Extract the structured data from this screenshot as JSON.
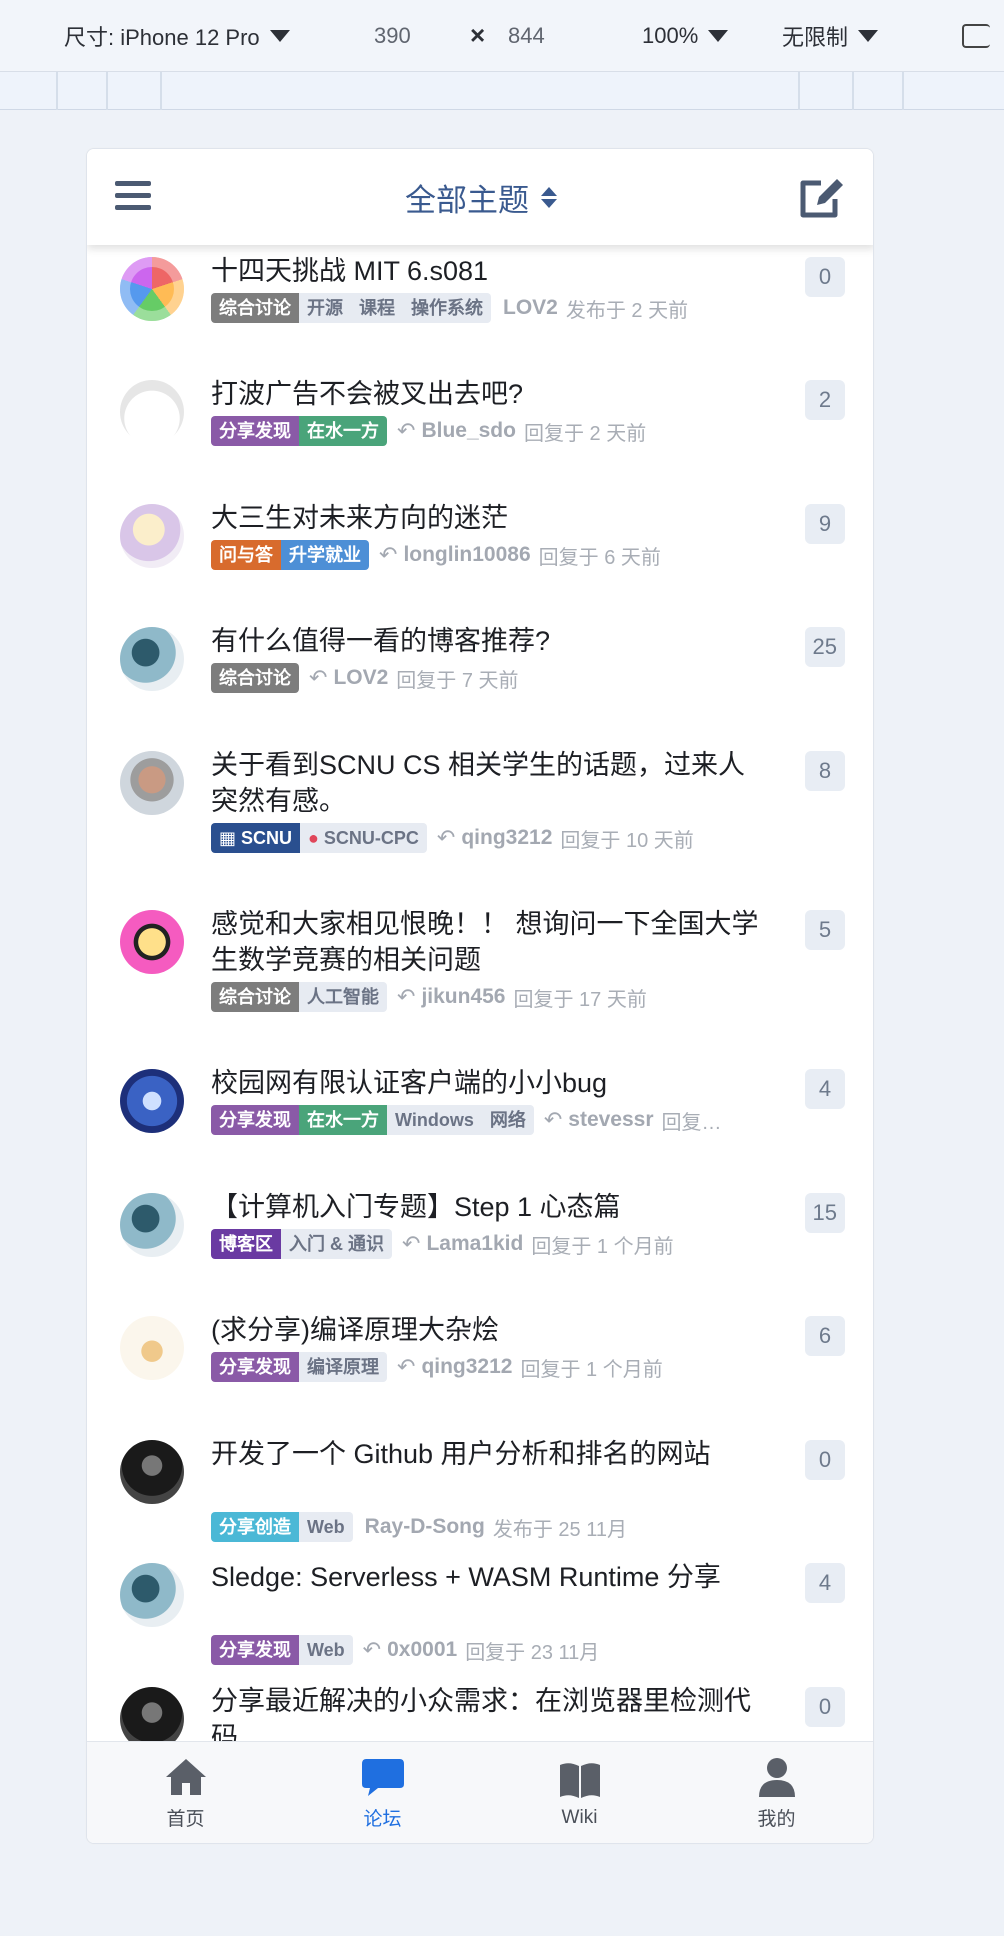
{
  "devtools": {
    "device": "尺寸: iPhone 12 Pro",
    "width": "390",
    "times": "×",
    "height": "844",
    "zoom": "100%",
    "throttle": "无限制"
  },
  "header": {
    "title": "全部主题"
  },
  "topics": [
    {
      "title": "十四天挑战 MIT 6.s081",
      "tags": [
        {
          "label": "综合讨论",
          "color": "#7d7d7d"
        },
        {
          "label": "开源",
          "sub": true
        },
        {
          "label": "课程",
          "sub": true
        },
        {
          "label": "操作系统",
          "sub": true
        }
      ],
      "reply": false,
      "user": "LOV2",
      "when": "发布于 2 天前",
      "count": "0"
    },
    {
      "title": "打波广告不会被叉出去吧?",
      "tags": [
        {
          "label": "分享发现",
          "color": "#8a5aa7"
        },
        {
          "label": "在水一方",
          "color": "#4aa47a"
        }
      ],
      "reply": true,
      "user": "Blue_sdo",
      "when": "回复于 2 天前",
      "count": "2"
    },
    {
      "title": "大三生对未来方向的迷茫",
      "tags": [
        {
          "label": "问与答",
          "color": "#d86b2d"
        },
        {
          "label": "升学就业",
          "color": "#4d8fd6"
        }
      ],
      "reply": true,
      "user": "longlin10086",
      "when": "回复于 6 天前",
      "count": "9"
    },
    {
      "title": "有什么值得一看的博客推荐?",
      "tags": [
        {
          "label": "综合讨论",
          "color": "#7d7d7d"
        }
      ],
      "reply": true,
      "user": "LOV2",
      "when": "回复于 7 天前",
      "count": "25"
    },
    {
      "title": "关于看到SCNU CS 相关学生的话题，过来人突然有感。",
      "tags": [
        {
          "label": "SCNU",
          "color": "#2a4f8f",
          "icon": true
        },
        {
          "label": "SCNU-CPC",
          "sub": true,
          "pin": true
        }
      ],
      "reply": true,
      "user": "qing3212",
      "when": "回复于 10 天前",
      "count": "8"
    },
    {
      "title": "感觉和大家相见恨晚！！ 想询问一下全国大学生数学竞赛的相关问题",
      "tags": [
        {
          "label": "综合讨论",
          "color": "#7d7d7d"
        },
        {
          "label": "人工智能",
          "sub": true
        }
      ],
      "reply": true,
      "user": "jikun456",
      "when": "回复于 17 天前",
      "count": "5"
    },
    {
      "title": "校园网有限认证客户端的小小bug",
      "tags": [
        {
          "label": "分享发现",
          "color": "#8a5aa7"
        },
        {
          "label": "在水一方",
          "color": "#4aa47a"
        },
        {
          "label": "Windows",
          "sub": true
        },
        {
          "label": "网络",
          "sub": true
        }
      ],
      "reply": true,
      "user": "stevessr",
      "when": "回复…",
      "count": "4"
    },
    {
      "title": "【计算机入门专题】Step 1 心态篇",
      "tags": [
        {
          "label": "博客区",
          "color": "#6a3aa2"
        },
        {
          "label": "入门 & 通识",
          "sub": true
        }
      ],
      "reply": true,
      "user": "Lama1kid",
      "when": "回复于 1 个月前",
      "count": "15"
    },
    {
      "title": "(求分享)编译原理大杂烩",
      "tags": [
        {
          "label": "分享发现",
          "color": "#8a5aa7"
        },
        {
          "label": "编译原理",
          "sub": true
        }
      ],
      "reply": true,
      "user": "qing3212",
      "when": "回复于 1 个月前",
      "count": "6"
    },
    {
      "title": "开发了一个 Github 用户分析和排名的网站",
      "tags": [
        {
          "label": "分享创造",
          "color": "#4bb8d6"
        },
        {
          "label": "Web",
          "sub": true
        }
      ],
      "reply": false,
      "user": "Ray-D-Song",
      "when": "发布于 25 11月",
      "count": "0"
    },
    {
      "title": "Sledge: Serverless + WASM Runtime 分享",
      "tags": [
        {
          "label": "分享发现",
          "color": "#8a5aa7"
        },
        {
          "label": "Web",
          "sub": true
        }
      ],
      "reply": true,
      "user": "0x0001",
      "when": "回复于 23 11月",
      "count": "4"
    },
    {
      "title": "分享最近解决的小众需求：在浏览器里检测代码",
      "tags": [],
      "reply": false,
      "user": "",
      "when": "",
      "count": "0"
    }
  ],
  "nav": {
    "home": "首页",
    "forum": "论坛",
    "wiki": "Wiki",
    "me": "我的"
  },
  "colors": {
    "accent": "#3a5a8f",
    "active_nav": "#1f6fe0"
  }
}
